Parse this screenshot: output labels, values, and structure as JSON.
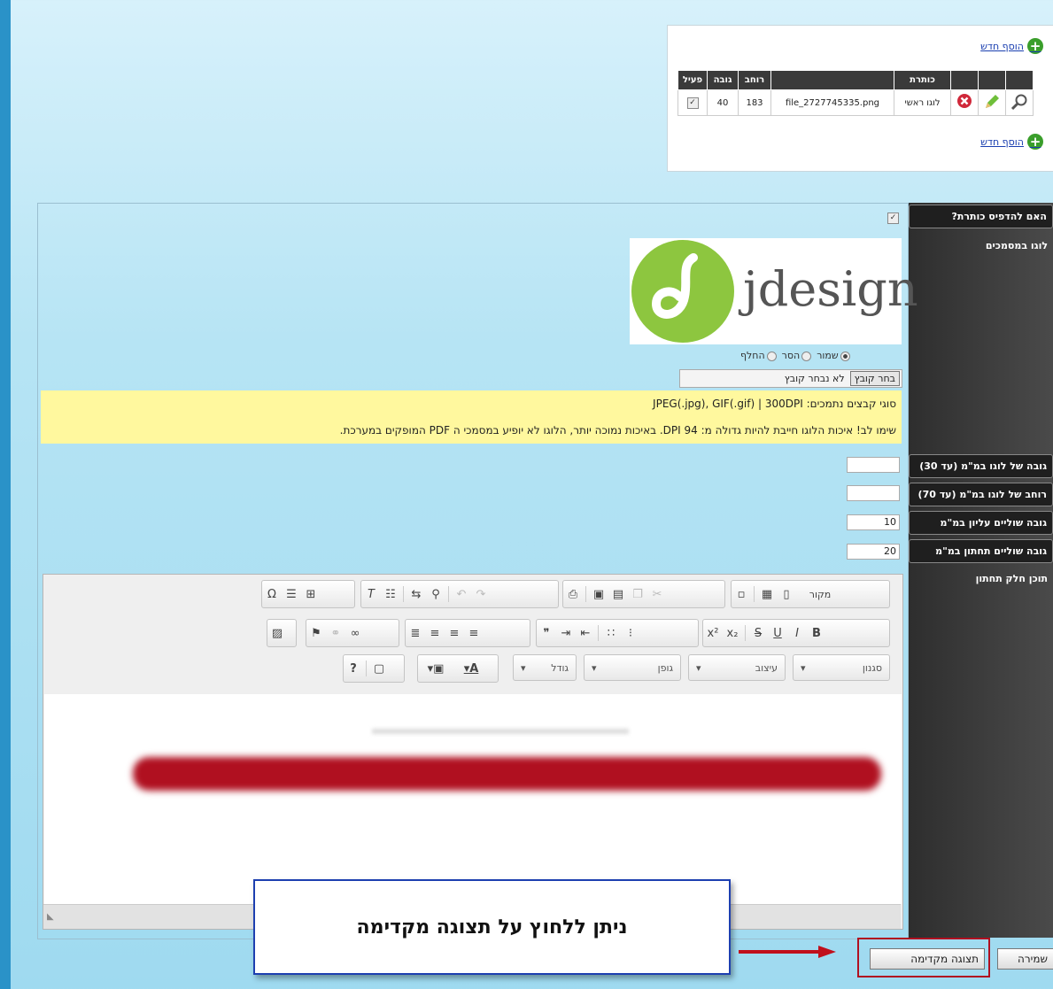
{
  "attachments": {
    "add_new": "הוסף חדש",
    "columns": [
      "פעיל",
      "גובה",
      "רוחב",
      "",
      "כותרת",
      "",
      "",
      ""
    ],
    "row": {
      "active": true,
      "height": "40",
      "width": "183",
      "file": "file_2727745335.png",
      "title": "לוגו ראשי"
    }
  },
  "sidebar": {
    "print_title": "האם להדפיס כותרת?",
    "logo_docs": "לוגו במסמכים",
    "logo_height": "גובה של לוגו במ\"מ (עד 30)",
    "logo_width": "רוחב של לוגו במ\"מ (עד 70)",
    "top_margin": "גובה שוליים עליון במ\"מ",
    "bottom_margin": "גובה שוליים תחתון במ\"מ",
    "footer_content": "תוכן חלק תחתון"
  },
  "form": {
    "logo_text": "jdesign",
    "radio_keep": "שמור",
    "radio_remove": "הסר",
    "radio_replace": "החלף",
    "file_button": "בחר קובץ",
    "file_none": "לא נבחר קובץ",
    "note1": "סוגי קבצים נתמכים: JPEG(.jpg), GIF(.gif) | 300DPI",
    "note2": "שימו לב! איכות הלוגו חייבת להיות גדולה מ: 94 DPI. באיכות נמוכה יותר, הלוגו לא יופיע במסמכי ה PDF המופקים במערכת.",
    "logo_height_val": "",
    "logo_width_val": "",
    "top_margin_val": "10",
    "bottom_margin_val": "20"
  },
  "editor": {
    "source": "מקור",
    "style": "סגנון",
    "format": "עיצוב",
    "font": "גופן",
    "size": "גודל"
  },
  "callout": "ניתן ללחוץ על תצוגה מקדימה",
  "buttons": {
    "preview": "תצוגה מקדימה",
    "save": "שמירה"
  }
}
